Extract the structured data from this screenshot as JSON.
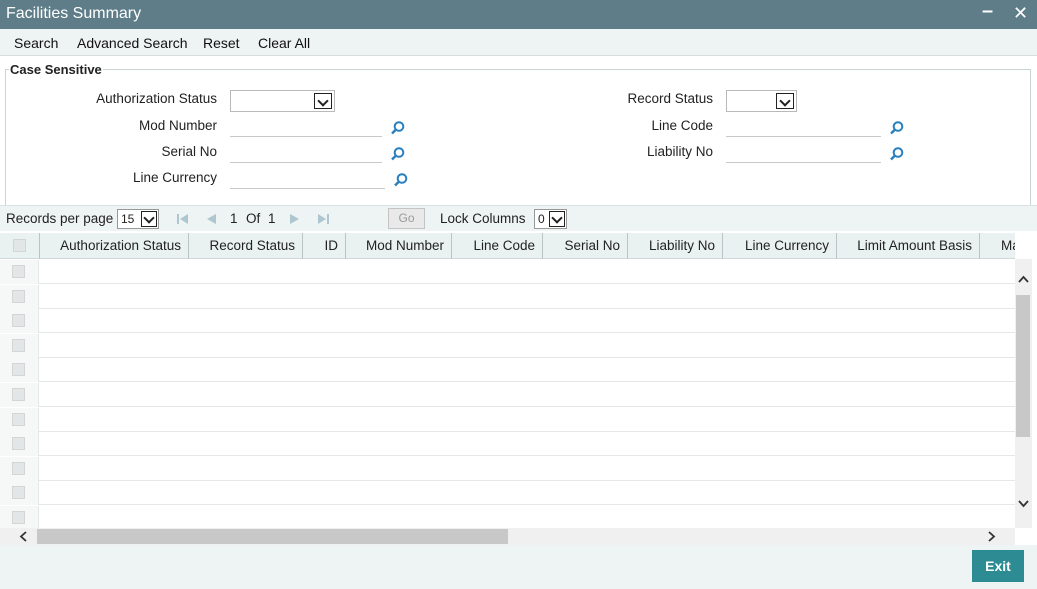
{
  "window": {
    "title": "Facilities Summary",
    "minimize_glyph": "–",
    "close_glyph": "✕"
  },
  "toolbar": {
    "search": "Search",
    "advanced_search": "Advanced Search",
    "reset": "Reset",
    "clear_all": "Clear All"
  },
  "criteria": {
    "legend": "Case Sensitive",
    "authorization_status": {
      "label": "Authorization Status",
      "value": ""
    },
    "record_status": {
      "label": "Record Status",
      "value": ""
    },
    "mod_number": {
      "label": "Mod Number",
      "value": ""
    },
    "line_code": {
      "label": "Line Code",
      "value": ""
    },
    "serial_no": {
      "label": "Serial No",
      "value": ""
    },
    "liability_no": {
      "label": "Liability No",
      "value": ""
    },
    "line_currency": {
      "label": "Line Currency",
      "value": ""
    }
  },
  "pager": {
    "records_per_page_label": "Records per page",
    "records_per_page_value": "15",
    "current_page": "1",
    "of_label": "Of",
    "total_pages": "1",
    "go_label": "Go",
    "lock_columns_label": "Lock Columns",
    "lock_columns_value": "0"
  },
  "grid": {
    "columns": [
      "Authorization Status",
      "Record Status",
      "ID",
      "Mod Number",
      "Line Code",
      "Serial No",
      "Liability No",
      "Line Currency",
      "Limit Amount Basis",
      "Ma"
    ],
    "rows": []
  },
  "footer": {
    "exit": "Exit"
  },
  "colors": {
    "titlebar": "#5e7d88",
    "toolbar": "#eef3f3",
    "exit_button": "#2d8b93",
    "lens_icon": "#2a7fbf"
  },
  "icons": [
    "search-lens-icon",
    "first-page-icon",
    "prev-page-icon",
    "next-page-icon",
    "last-page-icon",
    "dropdown-arrow-icon",
    "scroll-up-icon",
    "scroll-down-icon",
    "scroll-left-icon",
    "scroll-right-icon",
    "minimize-icon",
    "close-icon"
  ]
}
